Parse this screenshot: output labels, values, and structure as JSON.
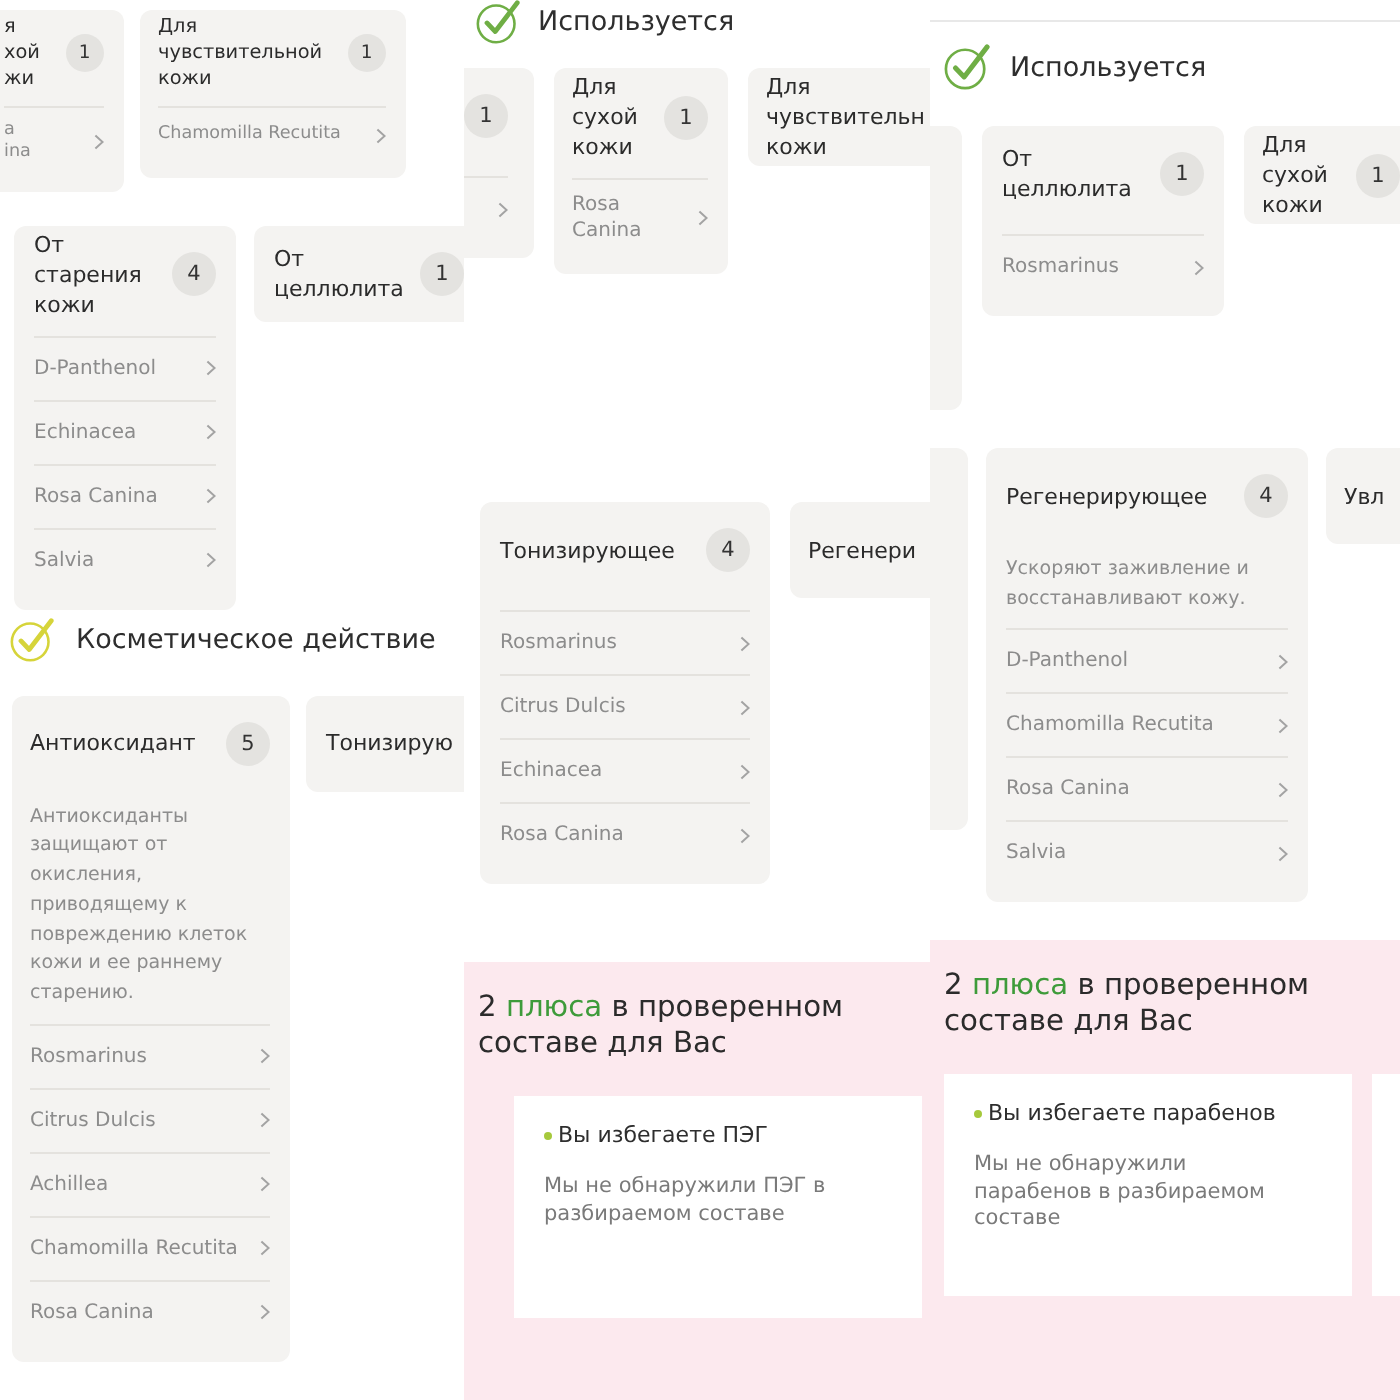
{
  "panels": [
    {
      "blocks": [
        {
          "kind": "cards",
          "cards": [
            {
              "kind": "category",
              "title": "я хой жи",
              "count": "1",
              "items": [
                {
                  "name": "a ina"
                }
              ]
            },
            {
              "kind": "category",
              "title": "Для чувствительной кожи",
              "count": "1",
              "items": [
                {
                  "name": "Chamomilla Recutita"
                }
              ]
            }
          ]
        },
        {
          "kind": "cards",
          "cards": [
            {
              "kind": "category",
              "title": "От старения кожи",
              "count": "4",
              "items": [
                {
                  "name": "D-Panthenol"
                },
                {
                  "name": "Echinacea"
                },
                {
                  "name": "Rosa Canina"
                },
                {
                  "name": "Salvia"
                }
              ]
            },
            {
              "kind": "category",
              "title": "От целлюлита",
              "count": "1"
            }
          ]
        },
        {
          "kind": "heading",
          "title": "Косметическое действие",
          "color": "#d6d43a"
        },
        {
          "kind": "cards",
          "cards": [
            {
              "kind": "category",
              "title": "Антиоксидант",
              "count": "5",
              "description": "Антиоксиданты защищают от окисления, приводящему к повреждению клеток кожи и ее раннему старению.",
              "items": [
                {
                  "name": "Rosmarinus"
                },
                {
                  "name": "Citrus Dulcis"
                },
                {
                  "name": "Achillea"
                },
                {
                  "name": "Chamomilla Recutita"
                },
                {
                  "name": "Rosa Canina"
                }
              ]
            },
            {
              "kind": "category",
              "title": "Тонизирую"
            }
          ]
        }
      ]
    },
    {
      "blocks": [
        {
          "kind": "heading",
          "title": "Используется",
          "color": "#6fae45"
        },
        {
          "kind": "cards",
          "cards": [
            {
              "kind": "category",
              "count": "1",
              "items": [
                {
                  "kind": "cut"
                }
              ]
            },
            {
              "kind": "category",
              "title": "Для сухой кожи",
              "count": "1",
              "items": [
                {
                  "name": "Rosa Canina"
                }
              ]
            },
            {
              "kind": "category",
              "title": "Для чувствительн кожи"
            }
          ]
        },
        {
          "kind": "cards",
          "cards": [
            {
              "kind": "category",
              "title": "Тонизирующее",
              "count": "4",
              "items": [
                {
                  "name": "Rosmarinus"
                },
                {
                  "name": "Citrus Dulcis"
                },
                {
                  "name": "Echinacea"
                },
                {
                  "name": "Rosa Canina"
                }
              ]
            },
            {
              "kind": "category",
              "title": "Регенери"
            }
          ]
        },
        {
          "kind": "benefits",
          "title_lead": "2",
          "title_accent": "плюса",
          "title_rest": "в проверенном составе для Вас",
          "cards": [
            {
              "kind": "benefit",
              "title": "Вы избегаете ПЭГ",
              "text": "Мы не обнаружили ПЭГ в разбираемом составе"
            }
          ]
        }
      ]
    },
    {
      "blocks": [
        {
          "kind": "heading",
          "title": "Используется",
          "color": "#6fae45"
        },
        {
          "kind": "cards",
          "cards": [
            {
              "kind": "edge"
            },
            {
              "kind": "category",
              "title": "От целлюлита",
              "count": "1",
              "items": [
                {
                  "name": "Rosmarinus"
                }
              ]
            },
            {
              "kind": "category",
              "title": "Для сухой кожи",
              "count": "1"
            }
          ]
        },
        {
          "kind": "cards",
          "cards": [
            {
              "kind": "edge"
            },
            {
              "kind": "category",
              "title": "Регенерирующее",
              "count": "4",
              "description": "Ускоряют заживление и восстанавливают кожу.",
              "items": [
                {
                  "name": "D-Panthenol"
                },
                {
                  "name": "Chamomilla Recutita"
                },
                {
                  "name": "Rosa Canina"
                },
                {
                  "name": "Salvia"
                }
              ]
            },
            {
              "kind": "category",
              "title": "Увл"
            }
          ]
        },
        {
          "kind": "benefits",
          "title_lead": "2",
          "title_accent": "плюса",
          "title_rest": "в проверенном составе для Вас",
          "cards": [
            {
              "kind": "benefit",
              "title": "Вы избегаете парабенов",
              "text": "Мы не обнаружили парабенов в разбираемом составе"
            },
            {
              "kind": "edge"
            }
          ]
        }
      ]
    }
  ]
}
